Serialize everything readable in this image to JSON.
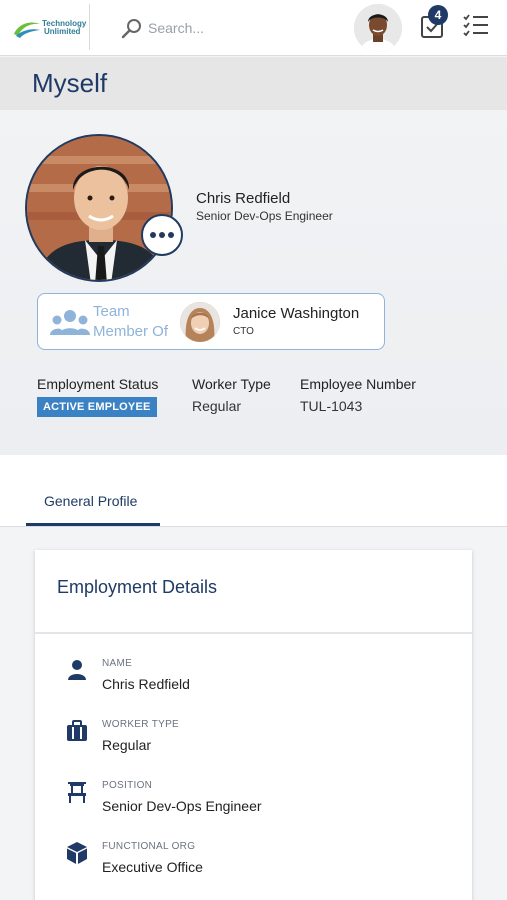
{
  "header": {
    "logo_line1": "Technology",
    "logo_line2": "Unlimited",
    "search_placeholder": "Search...",
    "task_count": "4",
    "icons": [
      "search-icon",
      "task-inbox-icon",
      "checklist-icon"
    ]
  },
  "page": {
    "title": "Myself"
  },
  "profile": {
    "name": "Chris Redfield",
    "job_title": "Senior Dev-Ops Engineer",
    "more_icon": "more-dots-icon",
    "team": {
      "label_line1": "Team",
      "label_line2": "Member Of",
      "manager_name": "Janice Washington",
      "manager_role": "CTO",
      "icon": "team-icon"
    },
    "meta": [
      {
        "label": "Employment Status",
        "value": "ACTIVE EMPLOYEE"
      },
      {
        "label": "Worker Type",
        "value": "Regular"
      },
      {
        "label": "Employee Number",
        "value": "TUL-1043"
      }
    ]
  },
  "tabs": [
    {
      "label": "General Profile",
      "active": true
    }
  ],
  "employment_details": {
    "title": "Employment Details",
    "fields": [
      {
        "label": "NAME",
        "value": "Chris Redfield",
        "icon": "person-icon"
      },
      {
        "label": "WORKER TYPE",
        "value": "Regular",
        "icon": "briefcase-icon"
      },
      {
        "label": "POSITION",
        "value": "Senior Dev-Ops Engineer",
        "icon": "chair-icon"
      },
      {
        "label": "FUNCTIONAL ORG",
        "value": "Executive Office",
        "icon": "cube-icon"
      }
    ]
  },
  "colors": {
    "brand": "#1f3a66",
    "status_pill": "#3b82c4",
    "team_border": "#8fb3d9"
  }
}
